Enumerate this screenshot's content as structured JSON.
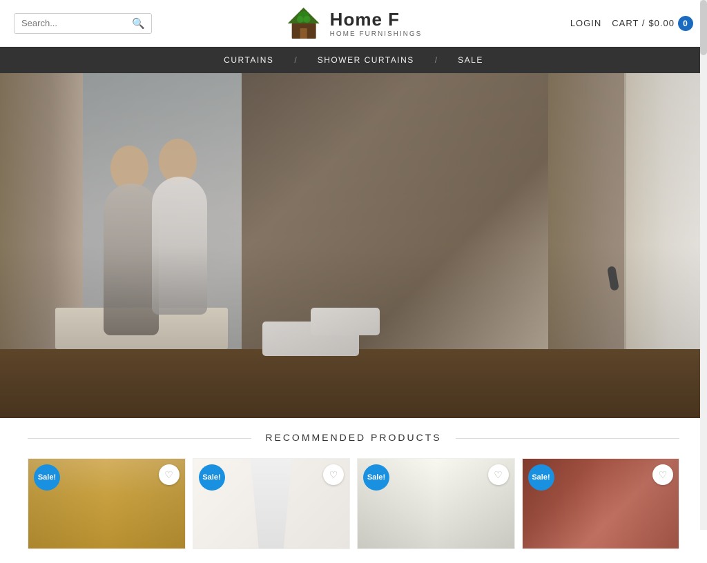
{
  "header": {
    "search": {
      "placeholder": "Search...",
      "icon": "🔍"
    },
    "logo": {
      "title": "Home F",
      "subtitle": "HOME FURNISHINGS"
    },
    "login_label": "LOGIN",
    "cart_label": "CART /",
    "cart_amount": "$0.00",
    "cart_count": "0"
  },
  "nav": {
    "items": [
      {
        "label": "CURTAINS",
        "id": "curtains"
      },
      {
        "label": "SHOWER CURTAINS",
        "id": "shower-curtains"
      },
      {
        "label": "SALE",
        "id": "sale"
      }
    ],
    "separator": "/"
  },
  "hero": {
    "alt": "Couple sitting at window with curtains"
  },
  "recommended": {
    "title": "RECOMMENDED PRODUCTS",
    "products": [
      {
        "id": "prod-1",
        "sale": "Sale!",
        "color": "gold",
        "type": "curtain-valance"
      },
      {
        "id": "prod-2",
        "sale": "Sale!",
        "color": "white-ruffle",
        "type": "shower-curtain"
      },
      {
        "id": "prod-3",
        "sale": "Sale!",
        "color": "white-panel",
        "type": "curtain-panel"
      },
      {
        "id": "prod-4",
        "sale": "Sale!",
        "color": "burgundy",
        "type": "curtain-valance"
      }
    ]
  }
}
